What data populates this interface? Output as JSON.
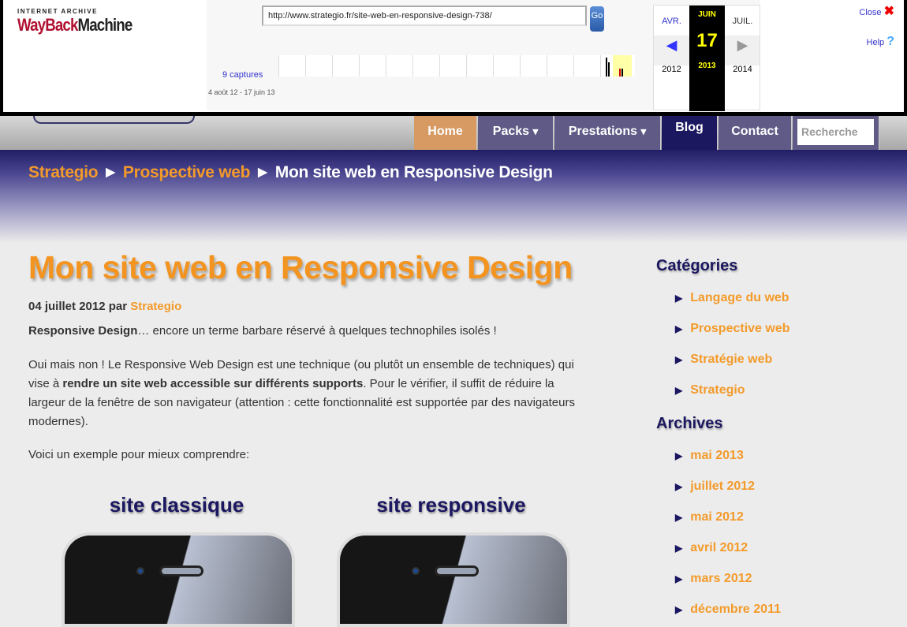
{
  "wayback": {
    "logo_top": "INTERNET ARCHIVE",
    "logo_a": "WayBack",
    "logo_b": "Machine",
    "url": "http://www.strategio.fr/site-web-en-responsive-design-738/",
    "go": "Go",
    "captures": "9 captures",
    "range": "4 août 12 - 17 juin 13",
    "prev_month": "AVR.",
    "cur_month": "JUIN",
    "next_month": "JUIL.",
    "day": "17",
    "prev_year": "2012",
    "cur_year": "2013",
    "next_year": "2014",
    "close": "Close",
    "help": "Help"
  },
  "nav": {
    "items": [
      "Home",
      "Packs",
      "Prestations",
      "Blog",
      "Contact"
    ],
    "search_placeholder": "Recherche"
  },
  "breadcrumb": {
    "home": "Strategio",
    "cat": "Prospective web",
    "current": "Mon site web en Responsive Design",
    "sep": "►"
  },
  "article": {
    "title": "Mon site web en Responsive Design",
    "date": "04 juillet 2012 par",
    "author": "Strategio",
    "p1_bold": "Responsive Design",
    "p1": "… encore un terme barbare réservé à quelques technophiles isolés !",
    "p2a": "Oui mais non ! Le Responsive Web Design est une technique (ou plutôt un ensemble de techniques) qui vise à ",
    "p2_bold": "rendre un site web accessible sur différents supports",
    "p2b": ". Pour le vérifier, il suffit de réduire la largeur de la fenêtre de son navigateur (attention : cette fonctionnalité est supportée par des navigateurs modernes).",
    "p3": "Voici un exemple pour mieux comprendre:",
    "label_left": "site classique",
    "label_right": "site responsive"
  },
  "sidebar": {
    "cat_title": "Catégories",
    "categories": [
      "Langage du web",
      "Prospective web",
      "Stratégie web",
      "Strategio"
    ],
    "arch_title": "Archives",
    "archives": [
      "mai 2013",
      "juillet 2012",
      "mai 2012",
      "avril 2012",
      "mars 2012",
      "décembre 2011"
    ]
  },
  "colors": {
    "accent": "#f39a2a",
    "navy": "#1b1760"
  }
}
